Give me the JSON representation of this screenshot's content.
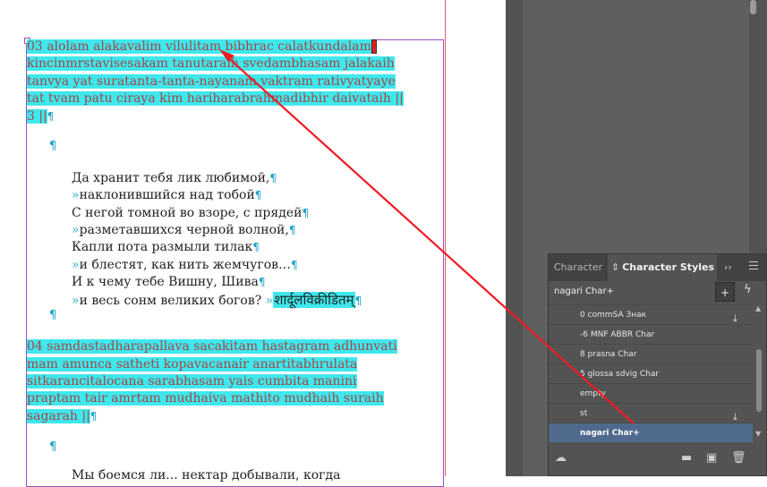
{
  "document": {
    "verse3_lines": [
      "03 alolam alakavalim vilulitam bibhrac calatkundalam",
      "kincinmrstavisesakam tanutaraih svedambhasam jalakaih",
      "tanvya yat suratanta-tanta-nayanam vaktram rativyatyaye",
      "tat tvam patu ciraya kim hariharabrahmadibhir daivataih ||",
      "3 ||"
    ],
    "russian_lines": [
      "Да хранит тебя лик любимой,",
      "наклонившийся над тобой",
      "С негой томной во взоре, с прядей",
      "разметавшихся черной волной,",
      "Капли пота размыли тилак",
      "и блестят, как нить жемчугов…",
      "И к чему тебе Вишну, Шива",
      "и весь сонм великих богов?"
    ],
    "devanagari": "शार्दूलविक्रीडितम्",
    "verse4_lines": [
      "04 samdastadharapallava sacakitam hastagram adhunvati",
      "mam amunca satheti kopavacanair anartitabhrulata",
      "sitkarancitalocana sarabhasam yais cumbita manini",
      "praptam tair amrtam mudhaiva mathito mudhaih suraih",
      "sagarah ||"
    ],
    "last_line": "Мы боемся ли... нектар добывали, когда"
  },
  "panel": {
    "tab_character": "Character",
    "tab_character_styles": "Character Styles",
    "tab_arrows": "››",
    "current_style": "nagari Char+",
    "styles": [
      {
        "label": "0 commSA Знак",
        "download_icon": true
      },
      {
        "label": "-6 MNF ABBR Char",
        "download_icon": false
      },
      {
        "label": "8 prasna Char",
        "download_icon": false
      },
      {
        "label": "5 glossa sdvig Char",
        "download_icon": false
      },
      {
        "label": "empty",
        "download_icon": false
      },
      {
        "label": "st",
        "download_icon": true
      },
      {
        "label": "nagari Char+",
        "download_icon": false,
        "selected": true
      }
    ],
    "icons": {
      "new_override": "plus-in-square-icon",
      "lightning": "lightning-icon",
      "cloud": "cloud-icon",
      "folder": "folder-icon",
      "new_style": "new-style-icon",
      "trash": "trash-icon"
    }
  },
  "colors": {
    "highlight": "#3ee8ec",
    "sanskrit_text": "#a4464a",
    "annotation_arrow": "#ee1c24",
    "selected_row": "#4f6a8c",
    "panel_bg": "#535353"
  }
}
